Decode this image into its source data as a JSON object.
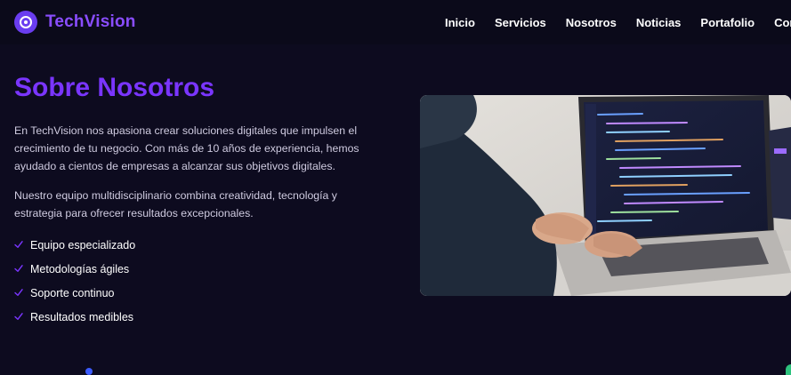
{
  "brand": {
    "name": "TechVision"
  },
  "nav": {
    "items": [
      "Inicio",
      "Servicios",
      "Nosotros",
      "Noticias",
      "Portafolio",
      "Contacto"
    ]
  },
  "about": {
    "title": "Sobre Nosotros",
    "paragraph1": "En TechVision nos apasiona crear soluciones digitales que impulsen el crecimiento de tu negocio. Con más de 10 años de experiencia, hemos ayudado a cientos de empresas a alcanzar sus objetivos digitales.",
    "paragraph2": "Nuestro equipo multidisciplinario combina creatividad, tecnología y estrategia para ofrecer resultados excepcionales.",
    "features": [
      "Equipo especializado",
      "Metodologías ágiles",
      "Soporte continuo",
      "Resultados medibles"
    ]
  },
  "icons": {
    "logo": "target-circle-icon",
    "feature": "check-icon"
  },
  "colors": {
    "background": "#0d0b1f",
    "accent": "#7a35ff",
    "logo_bg": "#6a3df0",
    "check": "#7a35ff"
  }
}
